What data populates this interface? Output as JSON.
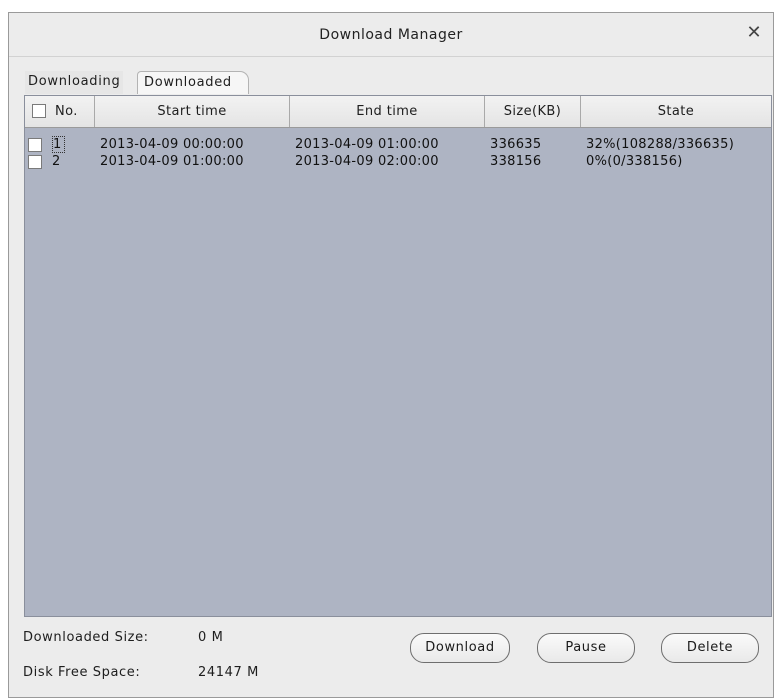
{
  "window": {
    "title": "Download Manager",
    "close_glyph": "✕"
  },
  "tabs": [
    {
      "label": "Downloading",
      "active": true
    },
    {
      "label": "Downloaded",
      "active": false
    }
  ],
  "table": {
    "columns": [
      "No.",
      "Start time",
      "End time",
      "Size(KB)",
      "State"
    ],
    "rows": [
      {
        "checked": false,
        "no": "1",
        "start": "2013-04-09 00:00:00",
        "end": "2013-04-09 01:00:00",
        "size": "336635",
        "state": "32%(108288/336635)"
      },
      {
        "checked": false,
        "no": "2",
        "start": "2013-04-09 01:00:00",
        "end": "2013-04-09 02:00:00",
        "size": "338156",
        "state": "0%(0/338156)"
      }
    ]
  },
  "footer": {
    "downloaded_size_label": "Downloaded Size:",
    "downloaded_size_value": "0 M",
    "disk_free_label": "Disk Free Space:",
    "disk_free_value": "24147 M"
  },
  "buttons": {
    "download": "Download",
    "pause": "Pause",
    "delete": "Delete"
  },
  "colors": {
    "list_background": "#aeb4c3",
    "window_background": "#ececec"
  },
  "icons": {
    "close": "close-icon"
  }
}
